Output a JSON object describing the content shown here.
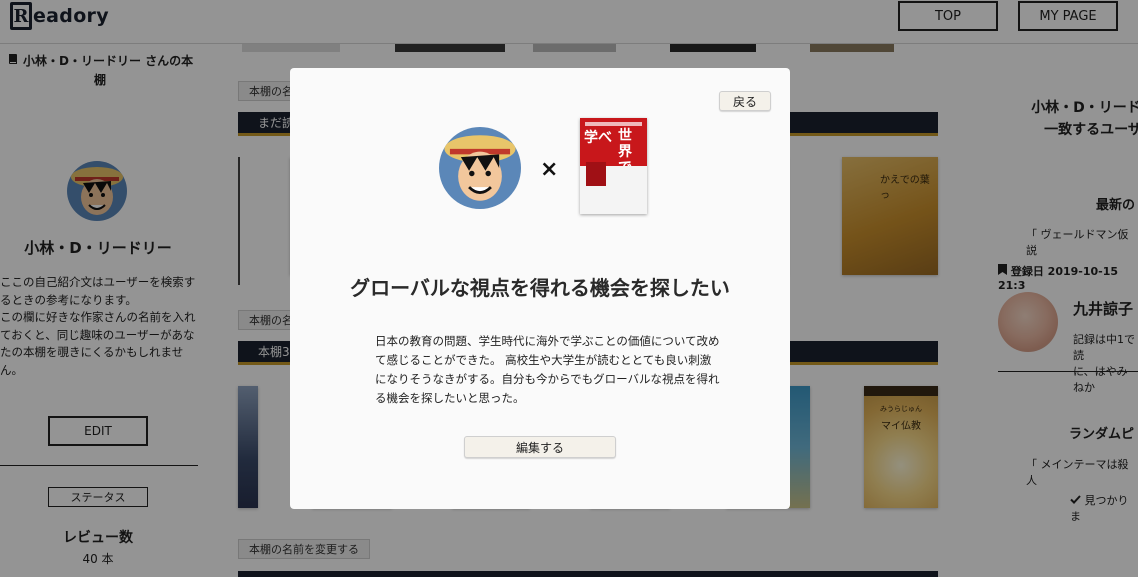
{
  "header": {
    "logo_letter": "R",
    "logo_text": "eadory",
    "nav_top": "TOP",
    "nav_mypage": "MY PAGE"
  },
  "left": {
    "shelf_title": "小林・D・リードリー さんの本棚",
    "user_name": "小林・D・リードリー",
    "bio": "ここの自己紹介文はユーザーを検索するときの参考になります。\nこの欄に好きな作家さんの名前を入れておくと、同じ趣味のユーザーがあなたの本棚を覗きにくるかもしれません。",
    "edit": "EDIT",
    "status": "ステータス",
    "review_label": "レビュー数",
    "review_count": "40 本"
  },
  "center": {
    "rename_1": "本棚の名前を変更する",
    "bar_1": "まだ読み終わっていない",
    "rename_2": "本棚の名前を変更する",
    "bar_2": "本棚3",
    "rename_3": "本棚の名前を変更する",
    "book_text_1": "かえでの葉っ",
    "book_text_2": "マイ仏教",
    "book_text_2_author": "みうらじゅん"
  },
  "right": {
    "title": "小林・D・リードリー\n一致するユーザー",
    "latest": "最新の",
    "quote_1": "「 ヴェールドマン仮説",
    "registered": "登録日 2019-10-15 21:3",
    "user2_name": "九井諒子",
    "user2_text": "記録は中1で読\nに、はやみねか",
    "random": "ランダムピ",
    "quote_2": "「 メインテーマは殺人",
    "found": "見つかりま"
  },
  "modal": {
    "back": "戻る",
    "times": "×",
    "book_cover_title_1": "世界で",
    "book_cover_title_2": "学べ",
    "title": "グローバルな視点を得れる機会を探したい",
    "body": "日本の教育の問題、学生時代に海外で学ぶことの価値について改めて感じることができた。 高校生や大学生が読むととても良い刺激になりそうなきがする。自分も今からでもグローバルな視点を得れる機会を探したいと思った。",
    "edit": "編集する"
  },
  "colors": {
    "shelf_bar": "#1a2230",
    "shelf_accent": "#c79a2a",
    "book_red": "#c8171b",
    "overlay": "rgba(0,0,0,0.42)"
  }
}
